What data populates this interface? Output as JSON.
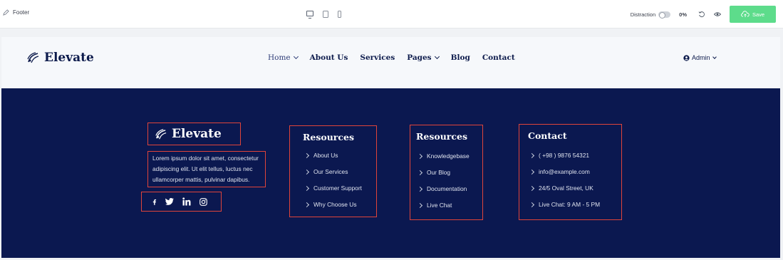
{
  "editor": {
    "title": "Footer",
    "distraction_label": "Distraction",
    "progress": "0%",
    "save_label": "Save"
  },
  "colors": {
    "accent_green": "#5ddc8b",
    "footer_bg": "#0b1850",
    "highlight_red": "#e0443a"
  },
  "header": {
    "brand": "Elevate",
    "nav": [
      {
        "label": "Home",
        "dropdown": true
      },
      {
        "label": "About Us"
      },
      {
        "label": "Services"
      },
      {
        "label": "Pages",
        "dropdown": true
      },
      {
        "label": "Blog"
      },
      {
        "label": "Contact"
      }
    ],
    "admin": "Admin"
  },
  "footer": {
    "brand": "Elevate",
    "description": "Lorem ipsum dolor sit amet, consectetur adipiscing elit. Ut elit tellus, luctus nec ullamcorper mattis, pulvinar dapibus.",
    "social": [
      "facebook-icon",
      "twitter-icon",
      "linkedin-icon",
      "instagram-icon"
    ],
    "columns": [
      {
        "title": "Resources",
        "items": [
          "About Us",
          "Our Services",
          "Customer Support",
          "Why Choose Us"
        ]
      },
      {
        "title": "Resources",
        "items": [
          "Knowledgebase",
          "Our Blog",
          "Documentation",
          "Live Chat"
        ]
      },
      {
        "title": "Contact",
        "items": [
          "( +98 ) 9876 54321",
          "info@example.com",
          "24/5 Oval Street, UK",
          "Live Chat: 9 AM - 5 PM"
        ]
      }
    ]
  }
}
